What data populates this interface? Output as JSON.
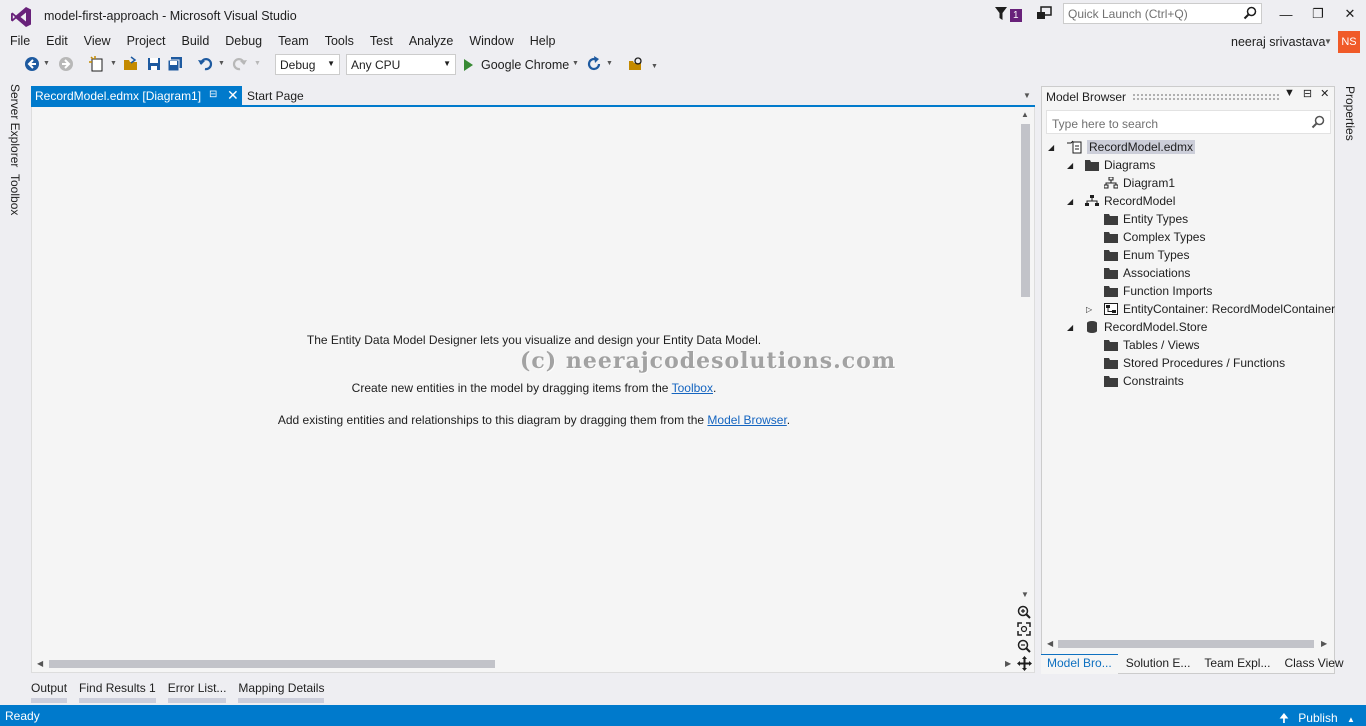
{
  "window": {
    "title": "model-first-approach - Microsoft Visual Studio",
    "notification_count": "1",
    "quick_launch_placeholder": "Quick Launch (Ctrl+Q)",
    "user_name": "neeraj srivastava",
    "user_initials": "NS"
  },
  "menu": [
    "File",
    "Edit",
    "View",
    "Project",
    "Build",
    "Debug",
    "Team",
    "Tools",
    "Test",
    "Analyze",
    "Window",
    "Help"
  ],
  "toolbar": {
    "configuration": "Debug",
    "platform": "Any CPU",
    "run_target": "Google Chrome"
  },
  "left_rail": {
    "server_explorer": "Server Explorer",
    "toolbox": "Toolbox"
  },
  "tabs": {
    "active": "RecordModel.edmx [Diagram1]",
    "second": "Start Page"
  },
  "designer": {
    "line1": "The Entity Data Model Designer lets you visualize and design your Entity Data Model.",
    "line2_prefix": "Create new entities in the model by dragging items from the ",
    "line2_link": "Toolbox",
    "line2_suffix": ".",
    "line3_prefix": "Add existing entities and relationships to this diagram by dragging them from the ",
    "line3_link": "Model Browser",
    "line3_suffix": ".",
    "watermark": "(c) neerajcodesolutions.com"
  },
  "model_browser": {
    "title": "Model Browser",
    "search_placeholder": "Type here to search",
    "tree": [
      {
        "label": "RecordModel.edmx",
        "level": 0,
        "expander": "open",
        "icon": "edmx-file-icon",
        "selected": true
      },
      {
        "label": "Diagrams",
        "level": 1,
        "expander": "open",
        "icon": "folder-icon"
      },
      {
        "label": "Diagram1",
        "level": 2,
        "expander": "none",
        "icon": "diagram-icon"
      },
      {
        "label": "RecordModel",
        "level": 1,
        "expander": "open",
        "icon": "model-icon"
      },
      {
        "label": "Entity Types",
        "level": 2,
        "expander": "none",
        "icon": "folder-icon"
      },
      {
        "label": "Complex Types",
        "level": 2,
        "expander": "none",
        "icon": "folder-icon"
      },
      {
        "label": "Enum Types",
        "level": 2,
        "expander": "none",
        "icon": "folder-icon"
      },
      {
        "label": "Associations",
        "level": 2,
        "expander": "none",
        "icon": "folder-icon"
      },
      {
        "label": "Function Imports",
        "level": 2,
        "expander": "none",
        "icon": "folder-icon"
      },
      {
        "label": "EntityContainer: RecordModelContainer",
        "level": 2,
        "expander": "closed",
        "icon": "container-icon"
      },
      {
        "label": "RecordModel.Store",
        "level": 1,
        "expander": "open",
        "icon": "database-icon"
      },
      {
        "label": "Tables / Views",
        "level": 2,
        "expander": "none",
        "icon": "folder-icon"
      },
      {
        "label": "Stored Procedures / Functions",
        "level": 2,
        "expander": "none",
        "icon": "folder-icon"
      },
      {
        "label": "Constraints",
        "level": 2,
        "expander": "none",
        "icon": "folder-icon"
      }
    ],
    "bottom_tabs": [
      "Model Bro...",
      "Solution E...",
      "Team Expl...",
      "Class View"
    ]
  },
  "right_rail": {
    "properties": "Properties"
  },
  "bottom_tabs": [
    "Output",
    "Find Results 1",
    "Error List...",
    "Mapping Details"
  ],
  "status": {
    "text": "Ready",
    "publish": "Publish"
  },
  "colors": {
    "accent": "#007acc",
    "vs_purple": "#68217a",
    "avatar": "#f05a28"
  }
}
